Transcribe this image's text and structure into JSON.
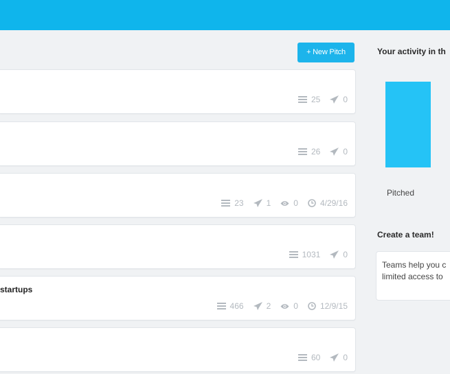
{
  "header": {},
  "toolbar": {
    "new_pitch_label": "+ New Pitch"
  },
  "pitches": [
    {
      "title": "",
      "list_count": "25",
      "sent_count": "0"
    },
    {
      "title": "",
      "list_count": "26",
      "sent_count": "0"
    },
    {
      "title": "",
      "list_count": "23",
      "sent_count": "1",
      "view_count": "0",
      "date": "4/29/16"
    },
    {
      "title": "",
      "list_count": "1031",
      "sent_count": "0"
    },
    {
      "title": "startups",
      "list_count": "466",
      "sent_count": "2",
      "view_count": "0",
      "date": "12/9/15"
    },
    {
      "title": "",
      "list_count": "60",
      "sent_count": "0"
    }
  ],
  "activity": {
    "heading": "Your activity in th",
    "bar_label": "Pitched"
  },
  "team": {
    "heading": "Create a team!",
    "line1": "Teams help you c",
    "line2": "limited access to"
  },
  "colors": {
    "brand": "#0fb5ec",
    "button": "#1cb4eb",
    "bar": "#25c3f6"
  }
}
